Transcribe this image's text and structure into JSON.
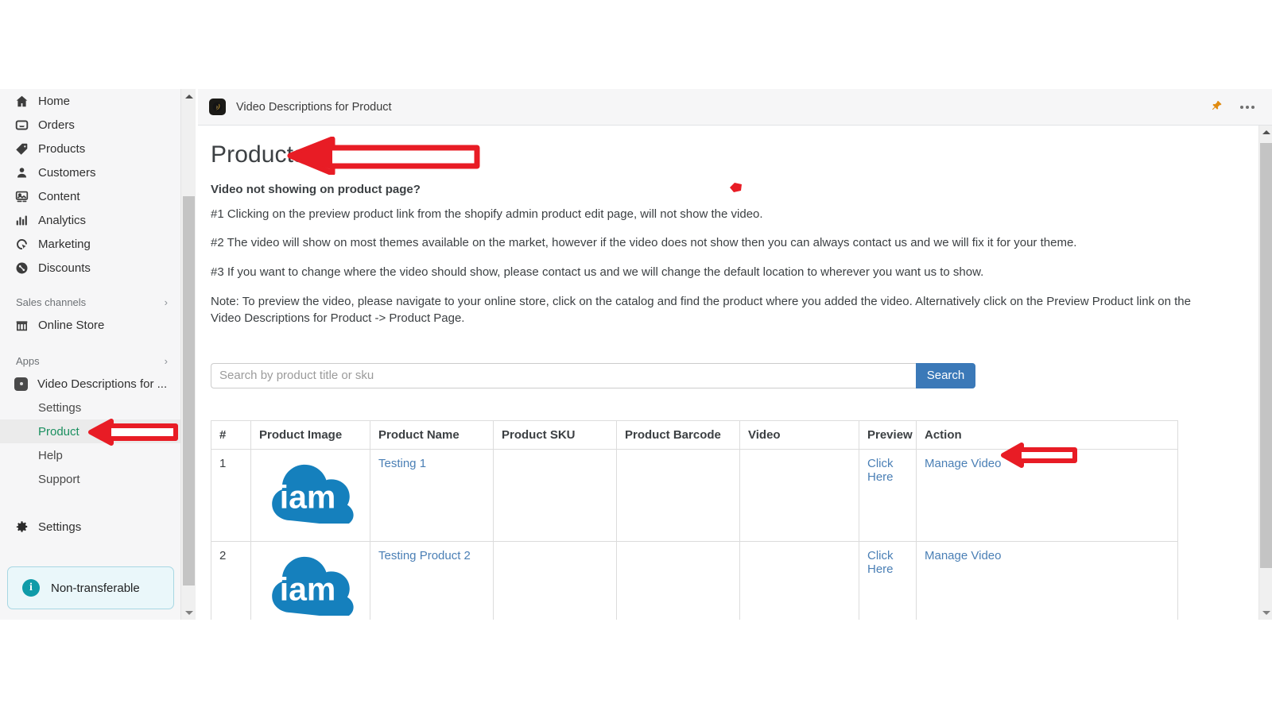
{
  "window": {
    "app_title": "Video Descriptions for Product",
    "app_icon": "video-app-icon",
    "pin_icon": "pushpin-icon",
    "more_icon": "more-options-icon"
  },
  "sidebar": {
    "nav": [
      {
        "label": "Home",
        "icon": "home-icon"
      },
      {
        "label": "Orders",
        "icon": "orders-inbox-icon"
      },
      {
        "label": "Products",
        "icon": "products-tag-icon"
      },
      {
        "label": "Customers",
        "icon": "customers-person-icon"
      },
      {
        "label": "Content",
        "icon": "content-image-icon"
      },
      {
        "label": "Analytics",
        "icon": "analytics-bars-icon"
      },
      {
        "label": "Marketing",
        "icon": "marketing-target-icon"
      },
      {
        "label": "Discounts",
        "icon": "discounts-percent-icon"
      }
    ],
    "sales_channels": {
      "label": "Sales channels",
      "chevron": "chevron-right-icon"
    },
    "online_store": {
      "label": "Online Store",
      "icon": "store-icon"
    },
    "apps": {
      "label": "Apps",
      "chevron": "chevron-right-icon"
    },
    "app_entry": {
      "label": "Video Descriptions for ...",
      "icon": "app-square-icon"
    },
    "app_sub_items": [
      {
        "label": "Settings",
        "active": false
      },
      {
        "label": "Product",
        "active": true
      },
      {
        "label": "Help",
        "active": false
      },
      {
        "label": "Support",
        "active": false
      }
    ],
    "settings": {
      "label": "Settings",
      "icon": "gear-icon"
    },
    "banner": {
      "label": "Non-transferable",
      "icon": "info-icon"
    },
    "active_accent_color": "#108060",
    "active_text_color": "#1a8f5f"
  },
  "main": {
    "page_title": "Products",
    "subheading": "Video not showing on product page?",
    "paragraphs": [
      "#1 Clicking on the preview product link from the shopify admin product edit page, will not show the video.",
      "#2 The video will show on most themes available on the market, however if the video does not show then you can always contact us and we will fix it for your theme.",
      "#3 If you want to change where the video should show, please contact us and we will change the default location to wherever you want us to show."
    ],
    "note": "Note: To preview the video, please navigate to your online store, click on the catalog and find the product where you added the video. Alternatively click on the Preview Product link on the Video Descriptions for Product -> Product Page.",
    "search": {
      "placeholder": "Search by product title or sku",
      "value": "",
      "button_label": "Search",
      "button_color": "#3b79b8"
    },
    "table": {
      "columns": [
        "#",
        "Product Image",
        "Product Name",
        "Product SKU",
        "Product Barcode",
        "Video",
        "Preview",
        "Action"
      ],
      "rows": [
        {
          "index": "1",
          "image_alt": "iam-cloud-logo",
          "name": "Testing 1",
          "sku": "",
          "barcode": "",
          "video": "",
          "preview": "Click Here",
          "action": "Manage Video"
        },
        {
          "index": "2",
          "image_alt": "iam-cloud-logo",
          "name": "Testing Product 2",
          "sku": "",
          "barcode": "",
          "video": "",
          "preview": "Click Here",
          "action": "Manage Video"
        }
      ],
      "link_color": "#4a7fb5"
    }
  },
  "annotations": {
    "arrow_color": "#e81c25",
    "arrows": [
      "arrow-to-products-title",
      "arrow-to-product-sidebar-item",
      "arrow-to-manage-video"
    ],
    "dot_mark": "red-diamond-mark"
  }
}
